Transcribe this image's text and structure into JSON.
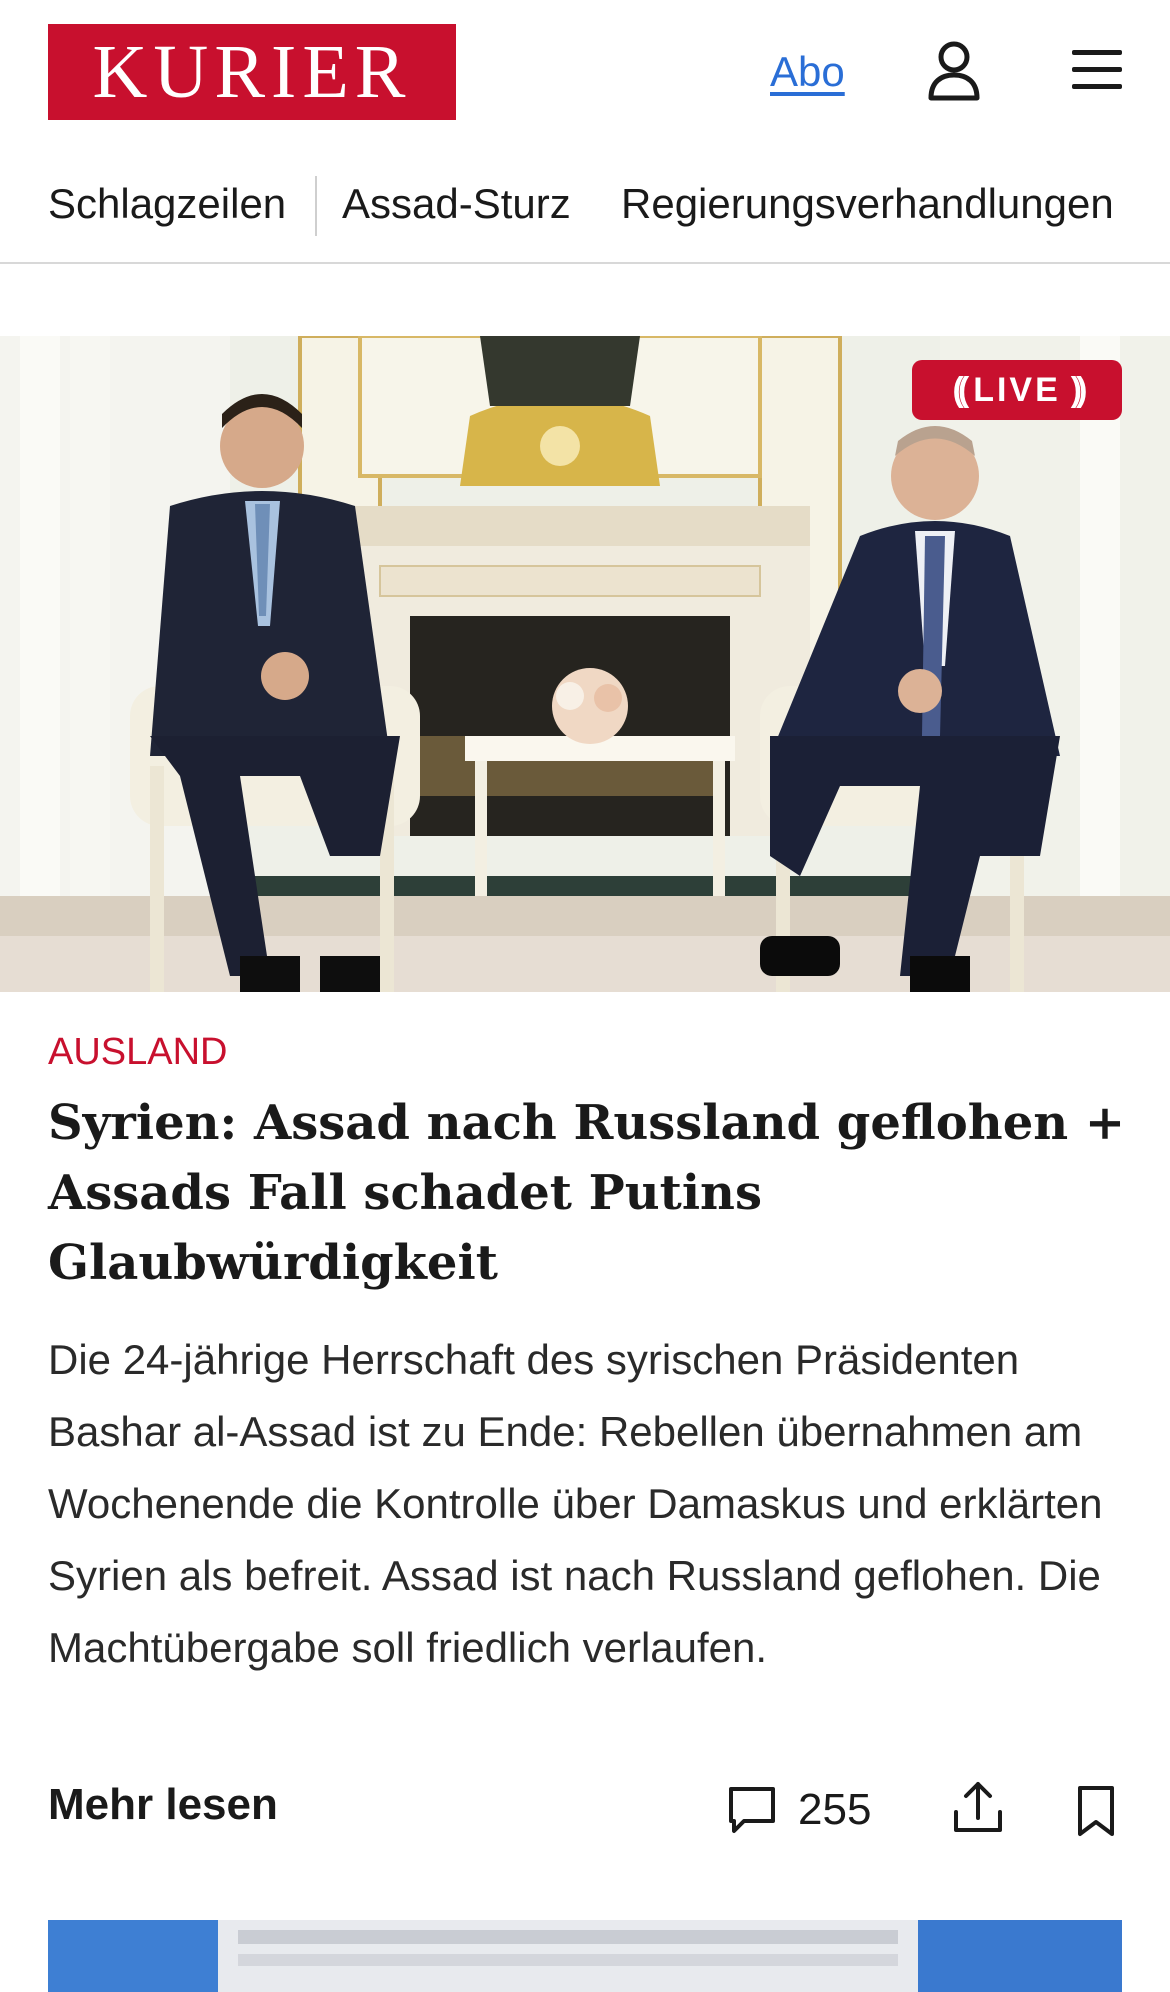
{
  "header": {
    "logo_text": "KURIER",
    "abo_label": "Abo",
    "user_icon": "user-icon",
    "menu_icon": "hamburger-menu-icon"
  },
  "nav": {
    "items": [
      {
        "label": "Schlagzeilen"
      },
      {
        "label": "Assad-Sturz"
      },
      {
        "label": "Regierungsverhandlungen"
      }
    ]
  },
  "article": {
    "live_label": "LIVE",
    "kicker": "AUSLAND",
    "headline": "Syrien: Assad nach Russland geflohen + Assads Fall schadet Putins Glaubwürdigkeit",
    "teaser": "Die 24-jährige Herrschaft des syrischen Präsidenten Bashar al-Assad ist zu Ende: Rebellen übernahmen am Wochenende die Kontrolle über Damaskus und erklärten Syrien als befreit. Assad ist nach Russland geflohen. Die Machtübergabe soll friedlich verlaufen.",
    "more_label": "Mehr lesen",
    "comment_count": "255"
  },
  "colors": {
    "brand_red": "#c8102e",
    "link_blue": "#2a6ed6"
  }
}
